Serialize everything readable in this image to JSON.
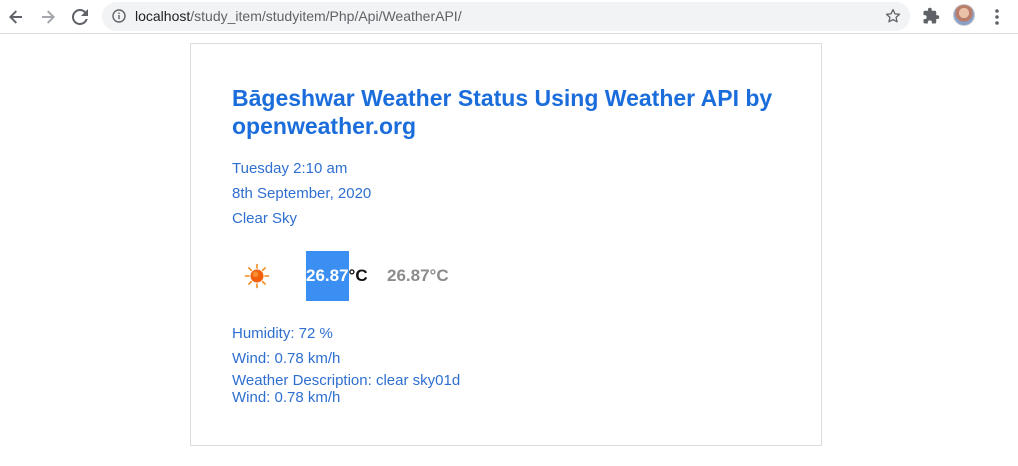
{
  "browser": {
    "url_host": "localhost",
    "url_path": "/study_item/studyitem/Php/Api/WeatherAPI/"
  },
  "page": {
    "title": "Bāgeshwar Weather Status Using Weather API by openweather.org",
    "day_time": "Tuesday 2:10 am",
    "date": "8th September, 2020",
    "condition": "Clear Sky",
    "temp_max_value": "26.87",
    "temp_max_unit": "°C",
    "temp_min": "26.87°C",
    "humidity": "Humidity: 72 %",
    "wind": "Wind: 0.78 km/h",
    "description": "Weather Description: clear sky01d",
    "wind_repeat": "Wind: 0.78 km/h",
    "weather_icon": "sun-icon",
    "accent_color": "#1a6ddb",
    "highlight_color": "#3b8ff2"
  }
}
